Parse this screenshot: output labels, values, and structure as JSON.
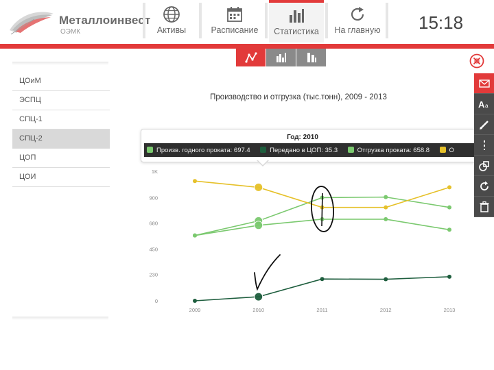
{
  "header": {
    "logo": {
      "name": "Металлоинвест",
      "sub": "ОЭМК"
    },
    "nav": [
      {
        "label": "Активы",
        "icon": "globe-icon"
      },
      {
        "label": "Расписание",
        "icon": "calendar-icon"
      },
      {
        "label": "Статистика",
        "icon": "bar-chart-icon",
        "active": true
      },
      {
        "label": "На главную",
        "icon": "refresh-icon"
      }
    ],
    "clock": "15:18",
    "accent": "#e23a3a"
  },
  "subtabs": [
    {
      "icon": "line-chart-icon",
      "active": true
    },
    {
      "icon": "bar-chart-icon"
    },
    {
      "icon": "column-chart-icon"
    }
  ],
  "sidebar": {
    "items": [
      {
        "label": "ЦОиМ"
      },
      {
        "label": "ЭСПЦ"
      },
      {
        "label": "СПЦ-1"
      },
      {
        "label": "СПЦ-2",
        "active": true
      },
      {
        "label": "ЦОП"
      },
      {
        "label": "ЦОИ"
      }
    ]
  },
  "tooltip": {
    "title": "Год: 2010",
    "items": [
      {
        "text": "Произв. годного проката: 697.4",
        "color": "#7bc96f"
      },
      {
        "text": "Передано в ЦОП: 35.3",
        "color": "#1e5e3e"
      },
      {
        "text": "Отгрузка проката: 658.8",
        "color": "#7bc96f"
      },
      {
        "text": "О",
        "color": "#e6c12a"
      }
    ]
  },
  "right_toolbar": [
    {
      "icon": "mail-icon",
      "active": true
    },
    {
      "icon": "font-size-icon"
    },
    {
      "icon": "pen-icon"
    },
    {
      "icon": "dashed-line-icon"
    },
    {
      "icon": "shapes-icon"
    },
    {
      "icon": "rotate-icon"
    },
    {
      "icon": "trash-icon"
    }
  ],
  "chart_data": {
    "type": "line",
    "title": "Производство и отгрузка (тыс.тонн), 2009 - 2013",
    "categories": [
      "2009",
      "2010",
      "2011",
      "2012",
      "2013"
    ],
    "ytick_labels": [
      "0",
      "230",
      "450",
      "680",
      "900",
      "1K"
    ],
    "ytick_values": [
      0,
      230,
      450,
      680,
      900,
      1130
    ],
    "ylim": [
      0,
      1130
    ],
    "series": [
      {
        "name": "Произв. годного проката",
        "color": "#7bc96f",
        "values": [
          570,
          697.4,
          900,
          905,
          815
        ]
      },
      {
        "name": "Передано в ЦОП",
        "color": "#1e5e3e",
        "values": [
          0,
          35.3,
          190,
          188,
          210
        ]
      },
      {
        "name": "Отгрузка проката",
        "color": "#7bc96f",
        "values": [
          570,
          658.8,
          712,
          712,
          620
        ]
      },
      {
        "series_color_note": "",
        "color": "#e6c12a",
        "values": [
          1045,
          990,
          815,
          815,
          990
        ]
      }
    ],
    "highlight_index": 1,
    "grid": false
  }
}
